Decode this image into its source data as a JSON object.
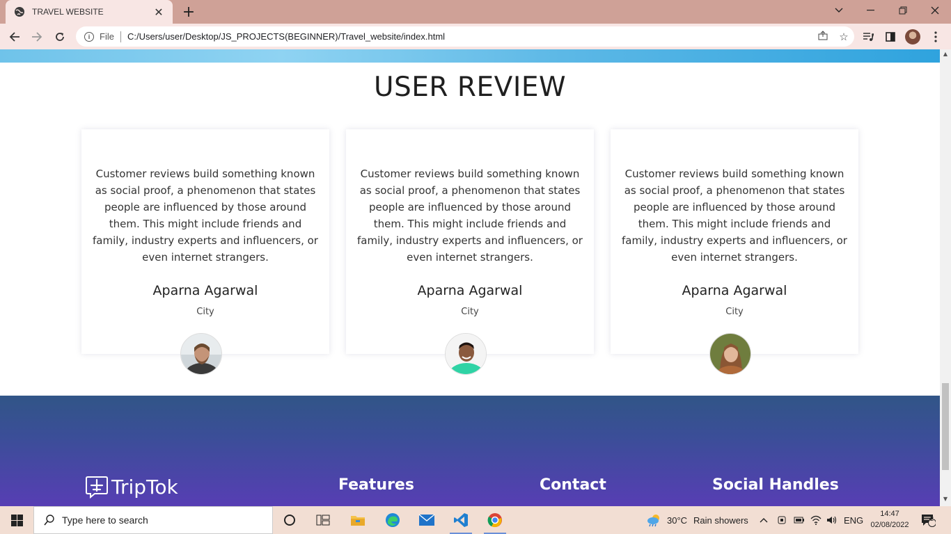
{
  "browser": {
    "tab_title": "TRAVEL WEBSITE",
    "tab_close": "✕",
    "new_tab": "+",
    "file_label": "File",
    "url": "C:/Users/user/Desktop/JS_PROJECTS(BEGINNER)/Travel_website/index.html"
  },
  "page": {
    "section_title": "USER REVIEW",
    "reviews": [
      {
        "text": "Customer reviews build something known as social proof, a phenomenon that states people are influenced by those around them. This might include friends and family, industry experts and influencers, or even internet strangers.",
        "name": "Aparna Agarwal",
        "city": "City"
      },
      {
        "text": "Customer reviews build something known as social proof, a phenomenon that states people are influenced by those around them. This might include friends and family, industry experts and influencers, or even internet strangers.",
        "name": "Aparna Agarwal",
        "city": "City"
      },
      {
        "text": "Customer reviews build something known as social proof, a phenomenon that states people are influenced by those around them. This might include friends and family, industry experts and influencers, or even internet strangers.",
        "name": "Aparna Agarwal",
        "city": "City"
      }
    ],
    "footer": {
      "brand": "TripTok",
      "features": "Features",
      "contact": "Contact",
      "social": "Social Handles"
    }
  },
  "taskbar": {
    "search_placeholder": "Type here to search",
    "weather_temp": "30°C",
    "weather_desc": "Rain showers",
    "language": "ENG",
    "time": "14:47",
    "date": "02/08/2022",
    "notifications": "2"
  },
  "colors": {
    "tabstrip": "#cfa197",
    "toolbar": "#f8e6e4",
    "footer_top": "#315587",
    "footer_bottom": "#5a3cb7",
    "taskbar": "#f2ded3"
  }
}
